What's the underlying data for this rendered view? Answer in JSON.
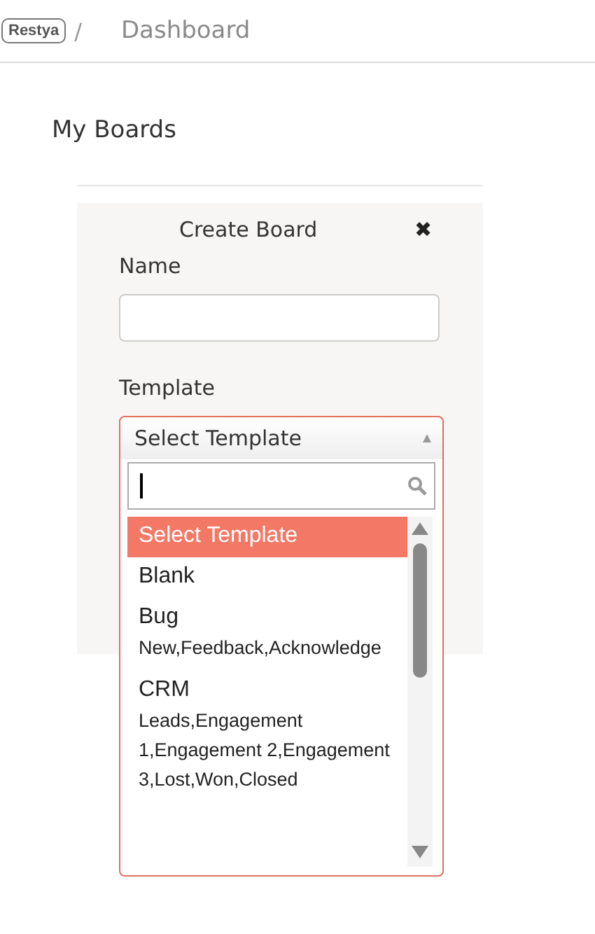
{
  "header": {
    "logo": "Restya",
    "separator": "/",
    "breadcrumb": "Dashboard"
  },
  "page_title": "My Boards",
  "dialog": {
    "title": "Create Board",
    "close": "✖",
    "name_label": "Name",
    "template_label": "Template",
    "template_select": {
      "value": "Select Template",
      "expanded": true,
      "options": [
        {
          "label": "Select Template",
          "selected": true
        },
        {
          "label": "Blank",
          "selected": false
        },
        {
          "label": "Bug",
          "description": "New,Feedback,Acknowledge",
          "selected": false
        },
        {
          "label": "CRM",
          "description": "Leads,Engagement 1,Engagement 2,Engagement 3,Lost,Won,Closed",
          "selected": false
        }
      ]
    }
  }
}
